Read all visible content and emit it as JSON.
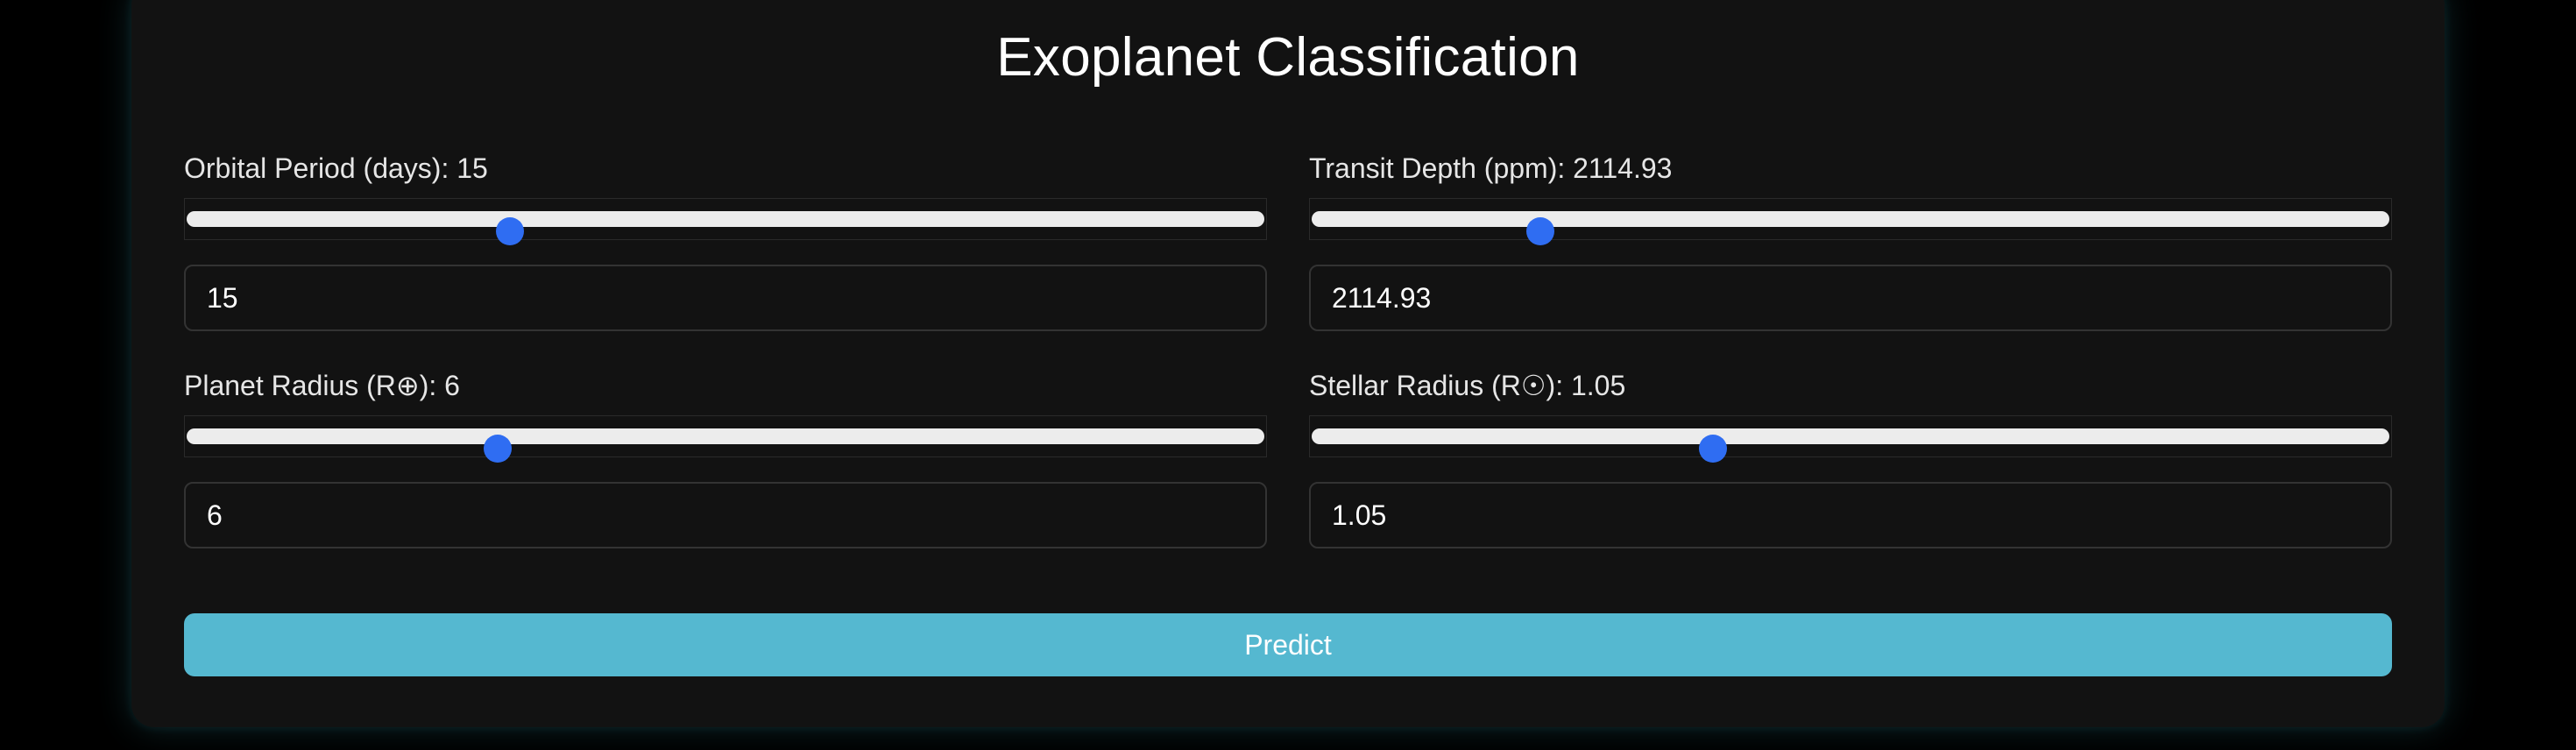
{
  "page": {
    "title": "Exoplanet Classification"
  },
  "fields": {
    "orbital_period": {
      "label_prefix": "Orbital Period (days): ",
      "value": "15",
      "slider_fraction": 0.3
    },
    "transit_depth": {
      "label_prefix": "Transit Depth (ppm): ",
      "value": "2114.93",
      "slider_fraction": 0.212
    },
    "planet_radius": {
      "label_prefix": "Planet Radius (R⊕): ",
      "value": "6",
      "slider_fraction": 0.289
    },
    "stellar_radius": {
      "label_prefix": "Stellar Radius (R☉): ",
      "value": "1.05",
      "slider_fraction": 0.372
    }
  },
  "actions": {
    "predict_label": "Predict"
  },
  "colors": {
    "background": "#000000",
    "card": "#121212",
    "slider_thumb": "#2f6df2",
    "slider_track": "#ececec",
    "predict_button": "#55b8d0"
  }
}
